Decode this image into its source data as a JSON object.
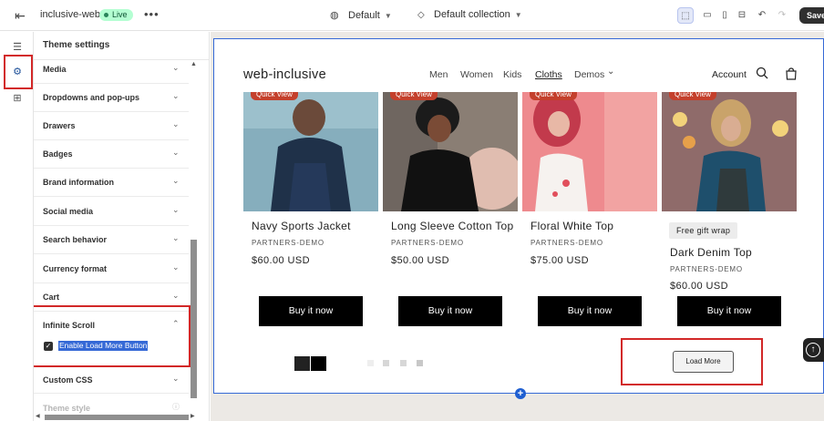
{
  "topbar": {
    "store_name": "inclusive-web",
    "status": "Live",
    "more": "•••",
    "theme": "Default",
    "collection": "Default collection",
    "save_label": "Save",
    "icons": [
      "exit-icon",
      "globe-icon",
      "collection-icon",
      "selection-tool-icon",
      "desktop-icon",
      "mobile-icon",
      "fullscreen-icon",
      "undo-icon",
      "redo-icon"
    ]
  },
  "rail": {
    "items": [
      "sections-icon",
      "theme-settings-icon",
      "apps-icon"
    ],
    "active": "theme-settings-icon"
  },
  "panel": {
    "title": "Theme settings",
    "rows": [
      {
        "label": "Media"
      },
      {
        "label": "Dropdowns and pop-ups"
      },
      {
        "label": "Drawers"
      },
      {
        "label": "Badges"
      },
      {
        "label": "Brand information"
      },
      {
        "label": "Social media"
      },
      {
        "label": "Search behavior"
      },
      {
        "label": "Currency format"
      },
      {
        "label": "Cart"
      },
      {
        "label": "Infinite Scroll"
      },
      {
        "label": "Custom CSS"
      },
      {
        "label": "Theme style"
      }
    ],
    "infinite_scroll": {
      "expanded": true,
      "checkbox_label": "Enable Load More Button",
      "checked": true
    }
  },
  "preview": {
    "logo": "web-inclusive",
    "nav": [
      "Men",
      "Women",
      "Kids",
      "Cloths",
      "Demos"
    ],
    "nav_active": "Cloths",
    "account": "Account",
    "quick_view": "Quick View",
    "products": [
      {
        "title": "Navy Sports Jacket",
        "vendor": "PARTNERS-DEMO",
        "price": "$60.00 USD"
      },
      {
        "title": "Long Sleeve Cotton Top",
        "vendor": "PARTNERS-DEMO",
        "price": "$50.00 USD"
      },
      {
        "title": "Floral White Top",
        "vendor": "PARTNERS-DEMO",
        "price": "$75.00 USD"
      },
      {
        "title": "Dark Denim Top",
        "vendor": "PARTNERS-DEMO",
        "price": "$60.00 USD",
        "badge": "Free gift wrap"
      }
    ],
    "buy_label": "Buy it now",
    "load_more": "Load More",
    "add_section": "+",
    "colors": {
      "accent": "#3569d6",
      "quick_view": "#c4402c",
      "highlight": "#d22828"
    }
  }
}
